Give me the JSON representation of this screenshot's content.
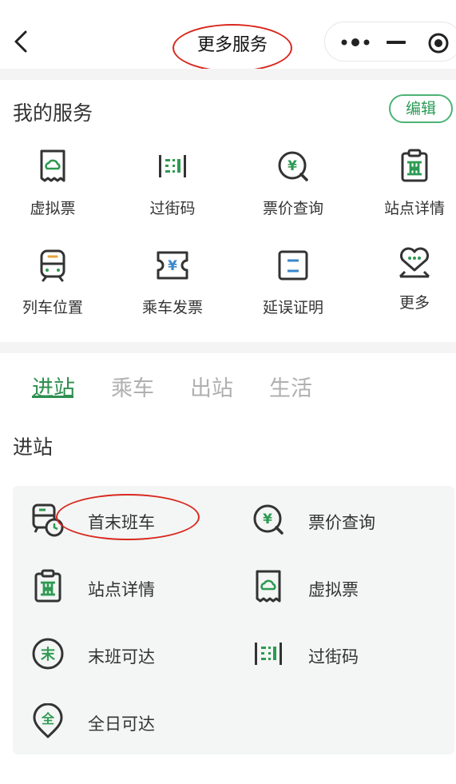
{
  "header": {
    "title": "更多服务",
    "back_icon": "chevron-left-icon",
    "capsule": {
      "more_icon": "more-dots-icon",
      "minimize_icon": "minus-icon",
      "close_icon": "target-close-icon"
    }
  },
  "my_services": {
    "title": "我的服务",
    "edit_label": "编辑",
    "items": [
      {
        "label": "虚拟票",
        "icon": "virtual-ticket-icon"
      },
      {
        "label": "过街码",
        "icon": "crossing-code-icon"
      },
      {
        "label": "票价查询",
        "icon": "fare-query-icon"
      },
      {
        "label": "站点详情",
        "icon": "station-detail-icon"
      },
      {
        "label": "列车位置",
        "icon": "train-location-icon"
      },
      {
        "label": "乘车发票",
        "icon": "ride-invoice-icon"
      },
      {
        "label": "延误证明",
        "icon": "delay-proof-icon"
      },
      {
        "label": "更多",
        "icon": "more-heart-icon"
      }
    ]
  },
  "tabs": [
    {
      "label": "进站",
      "active": true
    },
    {
      "label": "乘车",
      "active": false
    },
    {
      "label": "出站",
      "active": false
    },
    {
      "label": "生活",
      "active": false
    }
  ],
  "section": {
    "title": "进站",
    "items": [
      {
        "label": "首末班车",
        "icon": "first-last-train-icon"
      },
      {
        "label": "票价查询",
        "icon": "fare-query-icon"
      },
      {
        "label": "站点详情",
        "icon": "station-detail-icon"
      },
      {
        "label": "虚拟票",
        "icon": "virtual-ticket-icon"
      },
      {
        "label": "末班可达",
        "icon": "last-train-reach-icon"
      },
      {
        "label": "过街码",
        "icon": "crossing-code-icon"
      },
      {
        "label": "全日可达",
        "icon": "all-day-reach-icon"
      }
    ]
  },
  "colors": {
    "accent": "#2e8f4f",
    "icon_dark": "#333333",
    "annotation_red": "#d9281f",
    "band_gray": "#f4f4f4",
    "panel_bg": "#f3f6f5"
  }
}
